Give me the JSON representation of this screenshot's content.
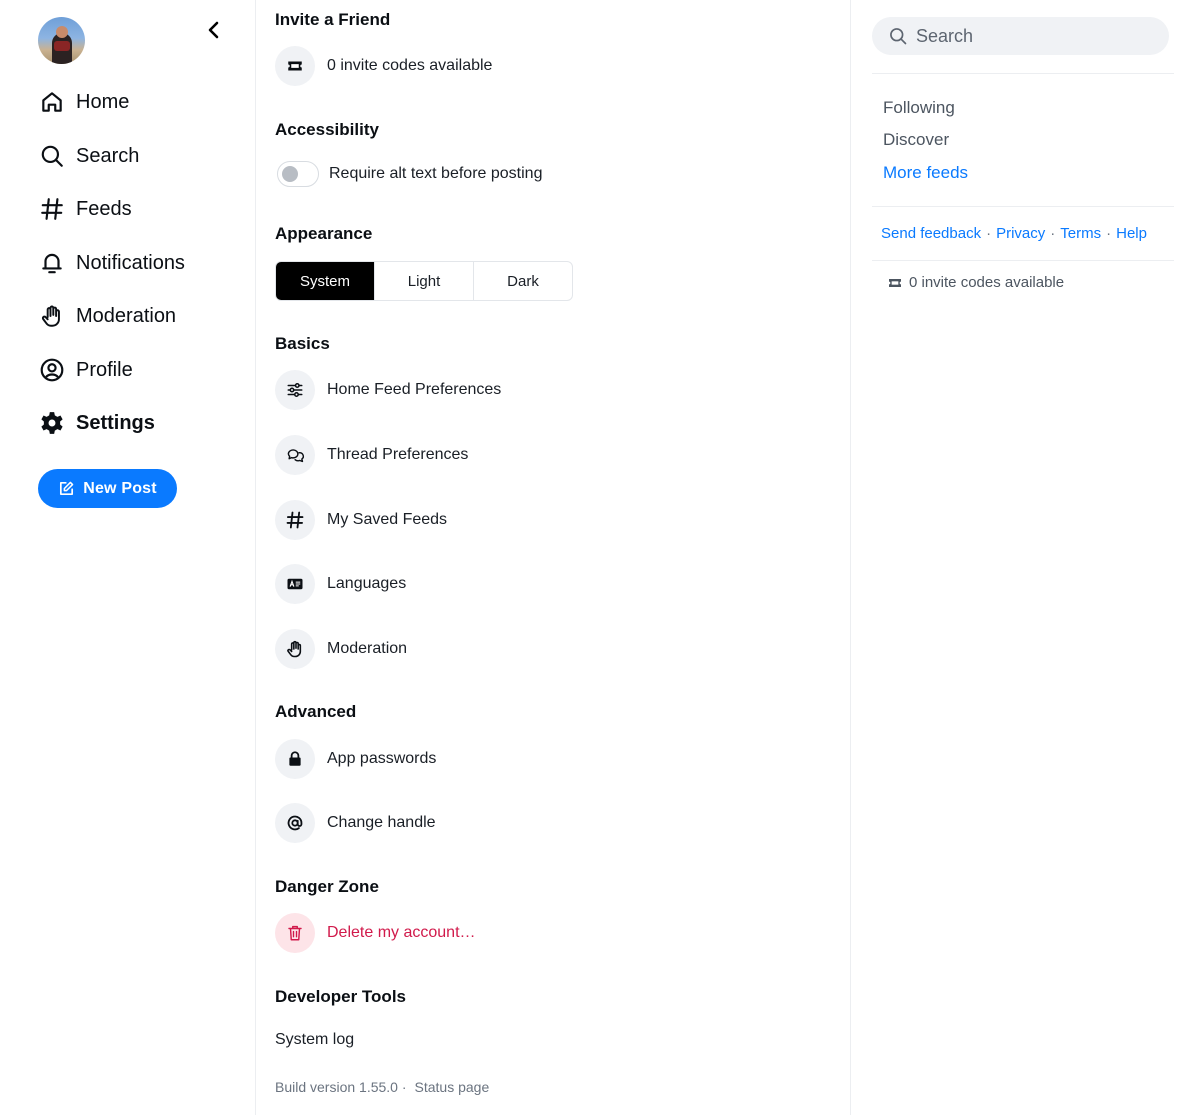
{
  "nav": {
    "items": [
      {
        "label": "Home",
        "icon": "home-icon"
      },
      {
        "label": "Search",
        "icon": "search-icon"
      },
      {
        "label": "Feeds",
        "icon": "hash-icon"
      },
      {
        "label": "Notifications",
        "icon": "bell-icon"
      },
      {
        "label": "Moderation",
        "icon": "hand-icon"
      },
      {
        "label": "Profile",
        "icon": "user-circle-icon"
      },
      {
        "label": "Settings",
        "icon": "gear-icon",
        "active": true
      }
    ],
    "new_post_label": "New Post",
    "accent": "#0a7aff"
  },
  "settings": {
    "invite": {
      "heading": "Invite a Friend",
      "label": "0 invite codes available"
    },
    "accessibility": {
      "heading": "Accessibility",
      "toggle_label": "Require alt text before posting",
      "toggle_on": false
    },
    "appearance": {
      "heading": "Appearance",
      "options": [
        "System",
        "Light",
        "Dark"
      ],
      "selected": "System"
    },
    "basics": {
      "heading": "Basics",
      "items": [
        {
          "label": "Home Feed Preferences",
          "icon": "sliders-icon"
        },
        {
          "label": "Thread Preferences",
          "icon": "chat-bubbles-icon"
        },
        {
          "label": "My Saved Feeds",
          "icon": "hash-icon"
        },
        {
          "label": "Languages",
          "icon": "language-icon"
        },
        {
          "label": "Moderation",
          "icon": "hand-icon"
        }
      ]
    },
    "advanced": {
      "heading": "Advanced",
      "items": [
        {
          "label": "App passwords",
          "icon": "lock-icon"
        },
        {
          "label": "Change handle",
          "icon": "at-icon"
        }
      ]
    },
    "danger": {
      "heading": "Danger Zone",
      "delete_label": "Delete my account…",
      "color": "#d11a4b"
    },
    "dev": {
      "heading": "Developer Tools",
      "system_log": "System log"
    },
    "build_version": "Build version 1.55.0 ·",
    "status_page": "Status page"
  },
  "right": {
    "search_placeholder": "Search",
    "feeds": [
      "Following",
      "Discover"
    ],
    "more_feeds": "More feeds",
    "links": [
      "Send feedback",
      "Privacy",
      "Terms",
      "Help"
    ],
    "link_sep": "·",
    "invite_label": "0 invite codes available"
  }
}
